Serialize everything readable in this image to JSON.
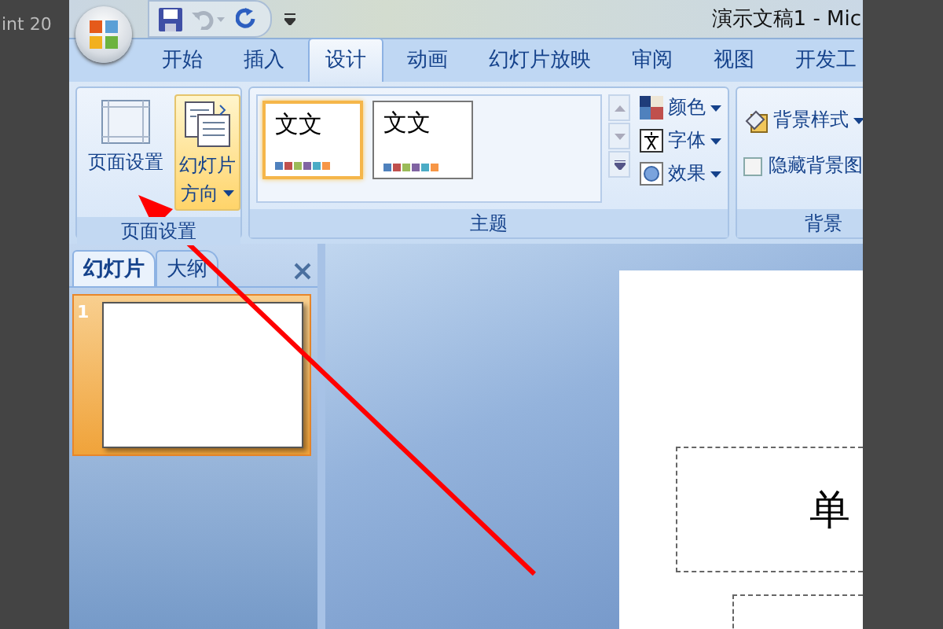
{
  "background_window": {
    "title_fragment": "int 20"
  },
  "window": {
    "title": "演示文稿1 - Mic"
  },
  "tabs": [
    {
      "label": "开始",
      "selected": false
    },
    {
      "label": "插入",
      "selected": false
    },
    {
      "label": "设计",
      "selected": true
    },
    {
      "label": "动画",
      "selected": false
    },
    {
      "label": "幻灯片放映",
      "selected": false
    },
    {
      "label": "审阅",
      "selected": false
    },
    {
      "label": "视图",
      "selected": false
    },
    {
      "label": "开发工",
      "selected": false
    }
  ],
  "ribbon": {
    "page_setup": {
      "label": "页面设置",
      "buttons": [
        {
          "kind": "page-setup",
          "lines": [
            "页面设置"
          ],
          "hover": false,
          "dropdown": false
        },
        {
          "kind": "orientation",
          "lines": [
            "幻灯片",
            "方向"
          ],
          "hover": true,
          "dropdown": true
        }
      ]
    },
    "themes": {
      "label": "主题",
      "items": [
        {
          "sample": "文文",
          "selected": true
        },
        {
          "sample": "文文",
          "selected": false
        }
      ],
      "options": [
        {
          "kind": "colors",
          "label": "颜色"
        },
        {
          "kind": "fonts",
          "label": "字体"
        },
        {
          "kind": "effects",
          "label": "效果"
        }
      ]
    },
    "background": {
      "label": "背景",
      "style_button": "背景样式",
      "hide_graphics": {
        "label": "隐藏背景图",
        "checked": false
      }
    }
  },
  "slides_pane": {
    "tabs": [
      {
        "label": "幻灯片",
        "selected": true
      },
      {
        "label": "大纲",
        "selected": false
      }
    ],
    "slides": [
      {
        "number": "1",
        "selected": true
      }
    ]
  },
  "slide": {
    "title_text": "单"
  }
}
